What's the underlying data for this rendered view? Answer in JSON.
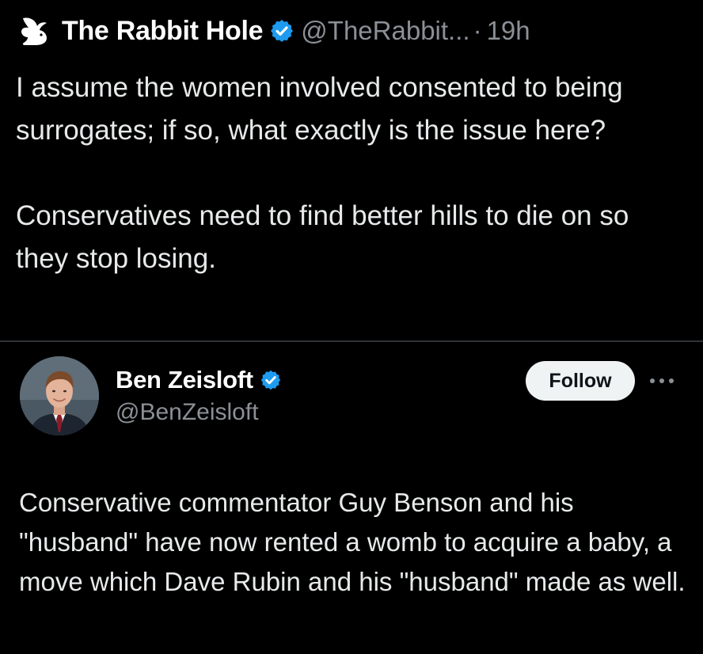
{
  "reply": {
    "display_name": "The Rabbit Hole",
    "handle": "@TheRabbit...",
    "separator": "·",
    "time": "19h",
    "paragraphs": [
      "I assume the women involved consented to being surrogates; if so, what exactly is the issue here?",
      "Conservatives need to find better hills to die on so they stop losing."
    ],
    "avatar_icon": "rabbit-logo-icon",
    "verified_icon": "verified-badge-icon"
  },
  "quoted": {
    "display_name": "Ben Zeisloft",
    "handle": "@BenZeisloft",
    "follow_label": "Follow",
    "more_icon": "more-options-icon",
    "verified_icon": "verified-badge-icon",
    "text": "Conservative commentator Guy Benson and his \"husband\" have now rented a womb to acquire a baby, a move which Dave Rubin and his \"husband\" made as well."
  },
  "colors": {
    "background": "#000000",
    "primary_text": "#e7e9ea",
    "secondary_text": "#8b9096",
    "verified_blue": "#1d9bf0",
    "divider": "#2f3336",
    "follow_button_bg": "#eff3f4"
  }
}
